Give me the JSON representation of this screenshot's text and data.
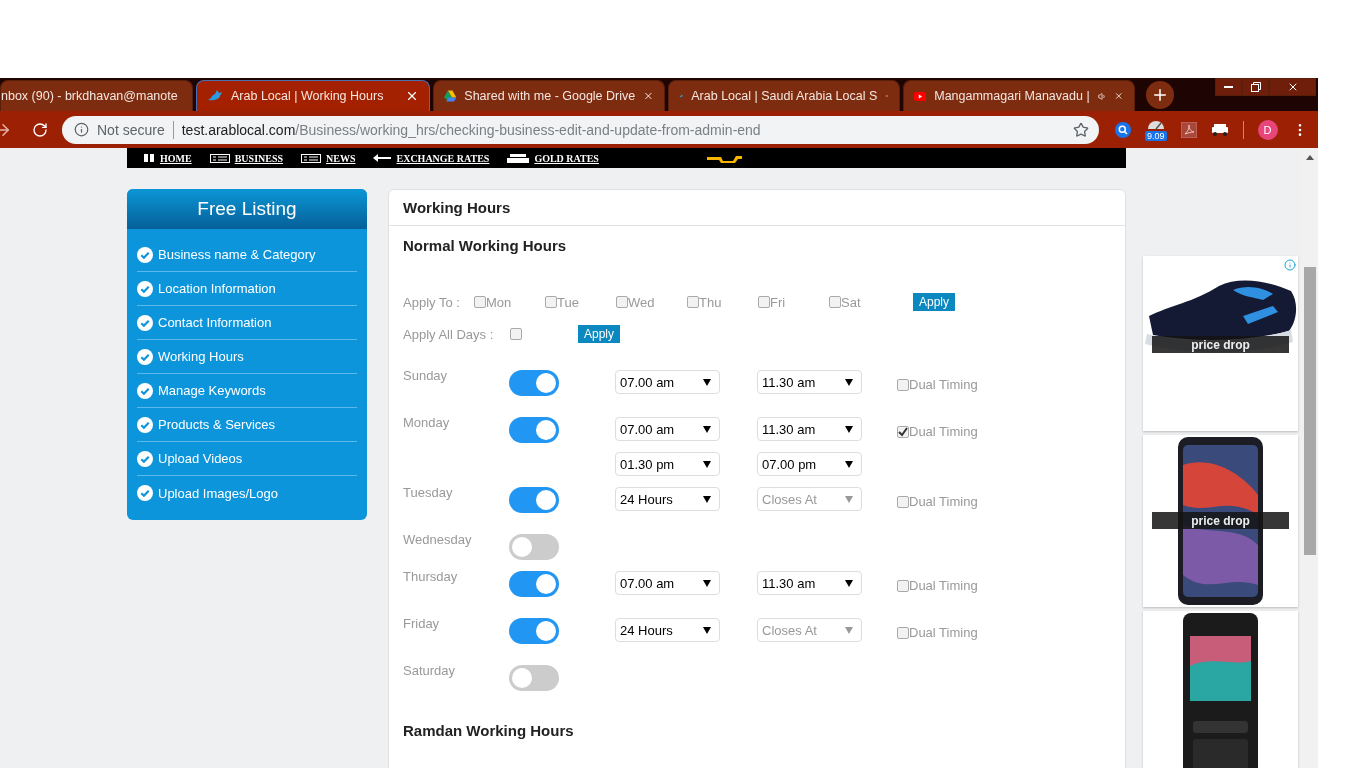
{
  "browser": {
    "tabs": [
      {
        "title": "nbox (90) - brkdhavan@manote",
        "selected": false,
        "audio": false
      },
      {
        "title": "Arab Local | Working Hours",
        "selected": true,
        "audio": false
      },
      {
        "title": "Shared with me - Google Drive",
        "selected": false,
        "audio": false
      },
      {
        "title": "Arab Local | Saudi Arabia Local S",
        "selected": false,
        "audio": false
      },
      {
        "title": "Mangammagari Manavadu |",
        "selected": false,
        "audio": true
      }
    ],
    "address": {
      "security": "Not secure",
      "host": "test.arablocal.com",
      "path": "/Business/working_hrs/checking-business-edit-and-update-from-admin-end"
    },
    "extension_badge": "9.09",
    "profile_initial": "D"
  },
  "nav": {
    "items": [
      {
        "label": "HOME"
      },
      {
        "label": "BUSINESS"
      },
      {
        "label": "NEWS"
      },
      {
        "label": "EXCHANGE RATES"
      },
      {
        "label": "GOLD RATES"
      }
    ]
  },
  "sidebar": {
    "title": "Free Listing",
    "items": [
      "Business name & Category",
      "Location Information",
      "Contact Information",
      "Working Hours",
      "Manage Keywords",
      "Products & Services",
      "Upload Videos",
      "Upload Images/Logo"
    ]
  },
  "main": {
    "title": "Working Hours",
    "section": "Normal Working Hours",
    "apply_to": {
      "label": "Apply To :",
      "days": [
        {
          "label": "Mon",
          "checked": false
        },
        {
          "label": "Tue",
          "checked": false
        },
        {
          "label": "Wed",
          "checked": false
        },
        {
          "label": "Thu",
          "checked": false
        },
        {
          "label": "Fri",
          "checked": false
        },
        {
          "label": "Sat",
          "checked": false
        }
      ],
      "button": "Apply"
    },
    "apply_all": {
      "label": "Apply All Days :",
      "checked": false,
      "button": "Apply"
    },
    "days": [
      {
        "name": "Sunday",
        "open": true,
        "slots": [
          {
            "opens": "07.00 am",
            "closes": "11.30 am",
            "closes_disabled": false
          }
        ],
        "dual_timing": {
          "label": "Dual Timing",
          "checked": false
        }
      },
      {
        "name": "Monday",
        "open": true,
        "slots": [
          {
            "opens": "07.00 am",
            "closes": "11.30 am",
            "closes_disabled": false
          },
          {
            "opens": "01.30 pm",
            "closes": "07.00 pm",
            "closes_disabled": false
          }
        ],
        "dual_timing": {
          "label": "Dual Timing",
          "checked": true
        }
      },
      {
        "name": "Tuesday",
        "open": true,
        "slots": [
          {
            "opens": "24 Hours",
            "closes": "Closes At",
            "closes_disabled": true
          }
        ],
        "dual_timing": {
          "label": "Dual Timing",
          "checked": false
        }
      },
      {
        "name": "Wednesday",
        "open": false
      },
      {
        "name": "Thursday",
        "open": true,
        "slots": [
          {
            "opens": "07.00 am",
            "closes": "11.30 am",
            "closes_disabled": false
          }
        ],
        "dual_timing": {
          "label": "Dual Timing",
          "checked": false
        }
      },
      {
        "name": "Friday",
        "open": true,
        "slots": [
          {
            "opens": "24 Hours",
            "closes": "Closes At",
            "closes_disabled": true
          }
        ],
        "dual_timing": {
          "label": "Dual Timing",
          "checked": false
        }
      },
      {
        "name": "Saturday",
        "open": false
      }
    ],
    "ramadan_title": "Ramdan Working Hours"
  },
  "ads": [
    {
      "kind": "picture",
      "badge": "price drop"
    },
    {
      "kind": "picture",
      "badge": "price drop"
    },
    {
      "kind": "picture"
    }
  ]
}
